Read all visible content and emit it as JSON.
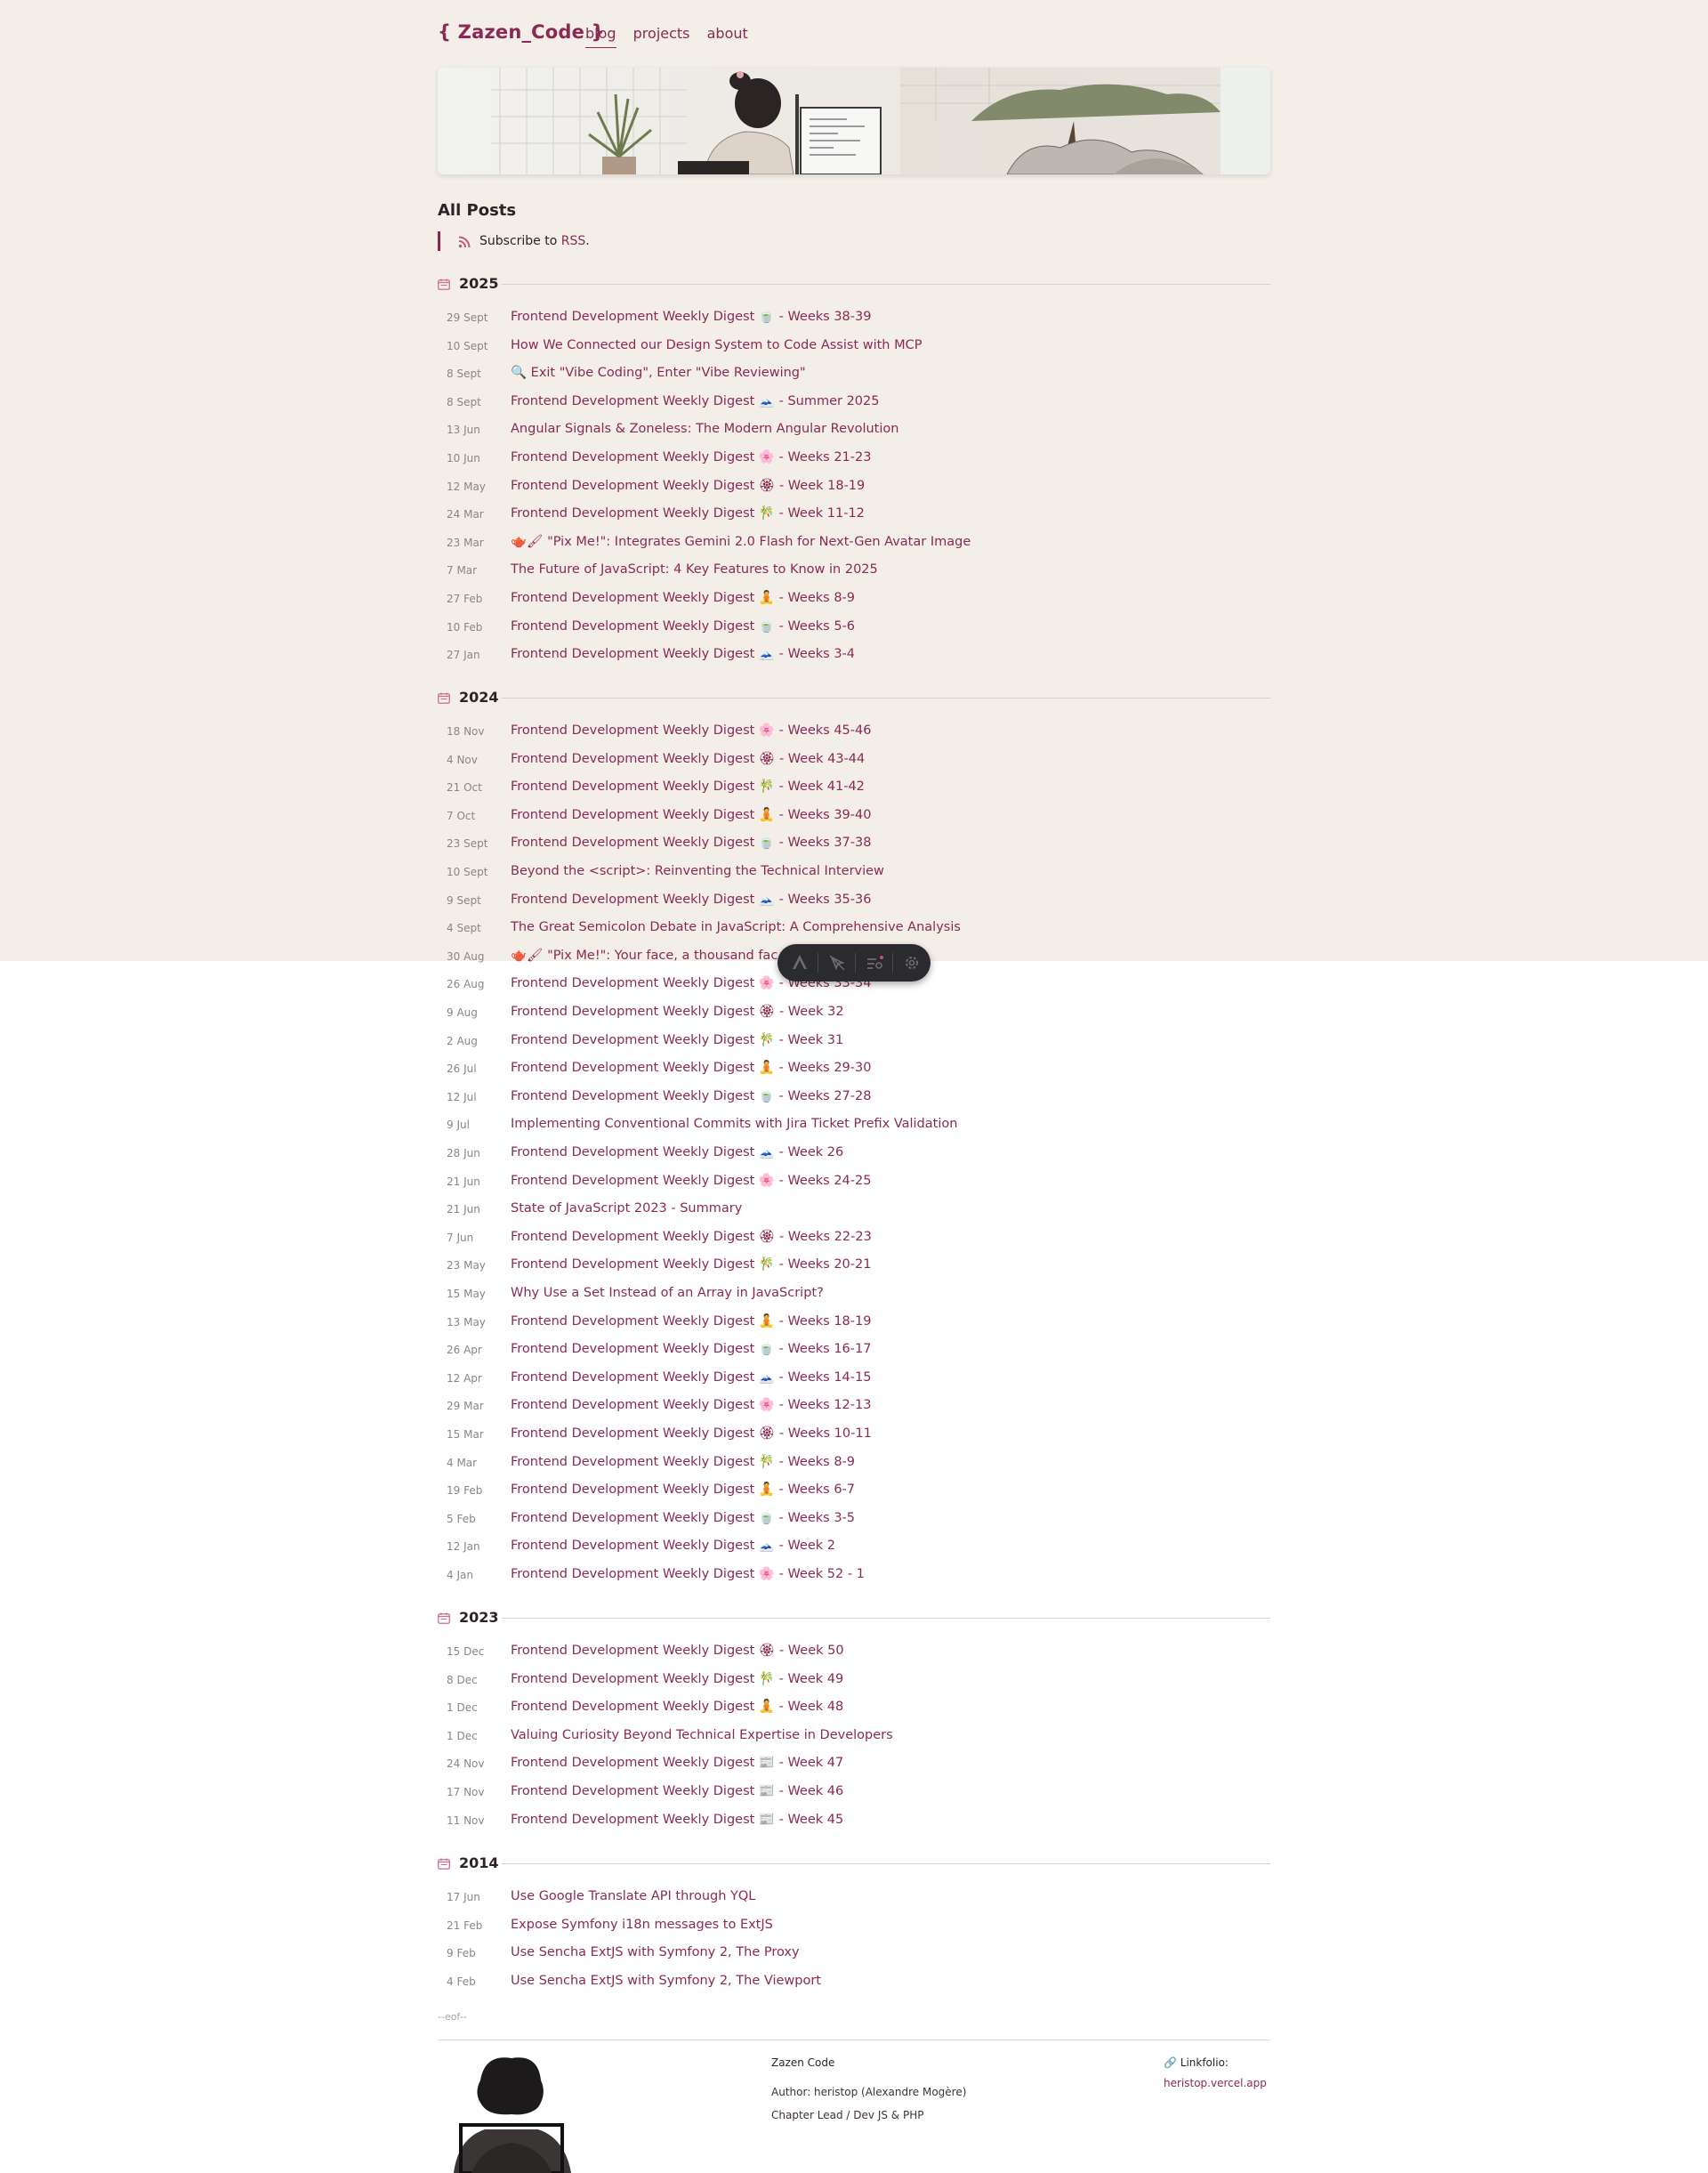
{
  "header": {
    "brand": "{ Zazen_Code }",
    "nav": [
      {
        "label": "blog",
        "active": true
      },
      {
        "label": "projects",
        "active": false
      },
      {
        "label": "about",
        "active": false
      }
    ]
  },
  "page_title": "All Posts",
  "rss": {
    "prefix": "Subscribe to",
    "link": "RSS",
    "suffix": "."
  },
  "years": [
    {
      "year": "2025",
      "posts": [
        {
          "date": "29 Sept",
          "title": "Frontend Development Weekly Digest 🍵 - Weeks 38-39"
        },
        {
          "date": "10 Sept",
          "title": "How We Connected our Design System to Code Assist with MCP"
        },
        {
          "date": "8 Sept",
          "title": "🔍 Exit \"Vibe Coding\", Enter \"Vibe Reviewing\""
        },
        {
          "date": "8 Sept",
          "title": "Frontend Development Weekly Digest 🗻 - Summer 2025"
        },
        {
          "date": "13 Jun",
          "title": "Angular Signals & Zoneless: The Modern Angular Revolution"
        },
        {
          "date": "10 Jun",
          "title": "Frontend Development Weekly Digest 🌸 - Weeks 21-23"
        },
        {
          "date": "12 May",
          "title": "Frontend Development Weekly Digest 🏵 - Week 18-19"
        },
        {
          "date": "24 Mar",
          "title": "Frontend Development Weekly Digest 🎋 - Week 11-12"
        },
        {
          "date": "23 Mar",
          "title": "🫖🖌 \"Pix Me!\": Integrates Gemini 2.0 Flash for Next-Gen Avatar Image"
        },
        {
          "date": "7 Mar",
          "title": "The Future of JavaScript: 4 Key Features to Know in 2025"
        },
        {
          "date": "27 Feb",
          "title": "Frontend Development Weekly Digest 🧘 - Weeks 8-9"
        },
        {
          "date": "10 Feb",
          "title": "Frontend Development Weekly Digest 🍵 - Weeks 5-6"
        },
        {
          "date": "27 Jan",
          "title": "Frontend Development Weekly Digest 🗻 - Weeks 3-4"
        }
      ]
    },
    {
      "year": "2024",
      "posts": [
        {
          "date": "18 Nov",
          "title": "Frontend Development Weekly Digest 🌸 - Weeks 45-46"
        },
        {
          "date": "4 Nov",
          "title": "Frontend Development Weekly Digest 🏵 - Week 43-44"
        },
        {
          "date": "21 Oct",
          "title": "Frontend Development Weekly Digest 🎋 - Week 41-42"
        },
        {
          "date": "7 Oct",
          "title": "Frontend Development Weekly Digest 🧘 - Weeks 39-40"
        },
        {
          "date": "23 Sept",
          "title": "Frontend Development Weekly Digest 🍵 - Weeks 37-38"
        },
        {
          "date": "10 Sept",
          "title": "Beyond the <script>: Reinventing the Technical Interview"
        },
        {
          "date": "9 Sept",
          "title": "Frontend Development Weekly Digest 🗻 - Weeks 35-36"
        },
        {
          "date": "4 Sept",
          "title": "The Great Semicolon Debate in JavaScript: A Comprehensive Analysis"
        },
        {
          "date": "30 Aug",
          "title": "🫖🖌 \"Pix Me!\": Your face, a thousand fac"
        },
        {
          "date": "26 Aug",
          "title": "Frontend Development Weekly Digest 🌸 - Weeks 33-34"
        },
        {
          "date": "9 Aug",
          "title": "Frontend Development Weekly Digest 🏵 - Week 32"
        },
        {
          "date": "2 Aug",
          "title": "Frontend Development Weekly Digest 🎋 - Week 31"
        },
        {
          "date": "26 Jul",
          "title": "Frontend Development Weekly Digest 🧘 - Weeks 29-30"
        },
        {
          "date": "12 Jul",
          "title": "Frontend Development Weekly Digest 🍵 - Weeks 27-28"
        },
        {
          "date": "9 Jul",
          "title": "Implementing Conventional Commits with Jira Ticket Prefix Validation"
        },
        {
          "date": "28 Jun",
          "title": "Frontend Development Weekly Digest 🗻 - Week 26"
        },
        {
          "date": "21 Jun",
          "title": "Frontend Development Weekly Digest 🌸 - Weeks 24-25"
        },
        {
          "date": "21 Jun",
          "title": "State of JavaScript 2023 - Summary"
        },
        {
          "date": "7 Jun",
          "title": "Frontend Development Weekly Digest 🏵 - Weeks 22-23"
        },
        {
          "date": "23 May",
          "title": "Frontend Development Weekly Digest 🎋 - Weeks 20-21"
        },
        {
          "date": "15 May",
          "title": "Why Use a Set Instead of an Array in JavaScript?"
        },
        {
          "date": "13 May",
          "title": "Frontend Development Weekly Digest 🧘 - Weeks 18-19"
        },
        {
          "date": "26 Apr",
          "title": "Frontend Development Weekly Digest 🍵 - Weeks 16-17"
        },
        {
          "date": "12 Apr",
          "title": "Frontend Development Weekly Digest 🗻 - Weeks 14-15"
        },
        {
          "date": "29 Mar",
          "title": "Frontend Development Weekly Digest 🌸 - Weeks 12-13"
        },
        {
          "date": "15 Mar",
          "title": "Frontend Development Weekly Digest 🏵 - Weeks 10-11"
        },
        {
          "date": "4 Mar",
          "title": "Frontend Development Weekly Digest 🎋 - Weeks 8-9"
        },
        {
          "date": "19 Feb",
          "title": "Frontend Development Weekly Digest 🧘 - Weeks 6-7"
        },
        {
          "date": "5 Feb",
          "title": "Frontend Development Weekly Digest 🍵 - Weeks 3-5"
        },
        {
          "date": "12 Jan",
          "title": "Frontend Development Weekly Digest 🗻 - Week 2"
        },
        {
          "date": "4 Jan",
          "title": "Frontend Development Weekly Digest 🌸 - Week 52 - 1"
        }
      ]
    },
    {
      "year": "2023",
      "posts": [
        {
          "date": "15 Dec",
          "title": "Frontend Development Weekly Digest 🏵 - Week 50"
        },
        {
          "date": "8 Dec",
          "title": "Frontend Development Weekly Digest 🎋 - Week 49"
        },
        {
          "date": "1 Dec",
          "title": "Frontend Development Weekly Digest 🧘 - Week 48"
        },
        {
          "date": "1 Dec",
          "title": "Valuing Curiosity Beyond Technical Expertise in Developers"
        },
        {
          "date": "24 Nov",
          "title": "Frontend Development Weekly Digest 📰 - Week 47"
        },
        {
          "date": "17 Nov",
          "title": "Frontend Development Weekly Digest 📰 - Week 46"
        },
        {
          "date": "11 Nov",
          "title": "Frontend Development Weekly Digest 📰 - Week 45"
        }
      ]
    },
    {
      "year": "2014",
      "posts": [
        {
          "date": "17 Jun",
          "title": "Use Google Translate API through YQL"
        },
        {
          "date": "21 Feb",
          "title": "Expose Symfony i18n messages to ExtJS"
        },
        {
          "date": "9 Feb",
          "title": "Use Sencha ExtJS with Symfony 2, The Proxy"
        },
        {
          "date": "4 Feb",
          "title": "Use Sencha ExtJS with Symfony 2, The Viewport"
        }
      ]
    }
  ],
  "eof": "--eof--",
  "footer": {
    "name": "Zazen Code",
    "author": "Author: heristop (Alexandre Mogère)",
    "role": "Chapter Lead / Dev JS & PHP",
    "link_label": "🔗 Linkfolio:",
    "link": "heristop.vercel.app"
  },
  "toolbar": {
    "icons": [
      "angular-devtools-icon",
      "inspect-icon",
      "filter-list-icon",
      "settings-gear-icon"
    ]
  },
  "colors": {
    "accent": "#8a2a54",
    "background": "#f3eee8",
    "date": "#8d8388"
  }
}
